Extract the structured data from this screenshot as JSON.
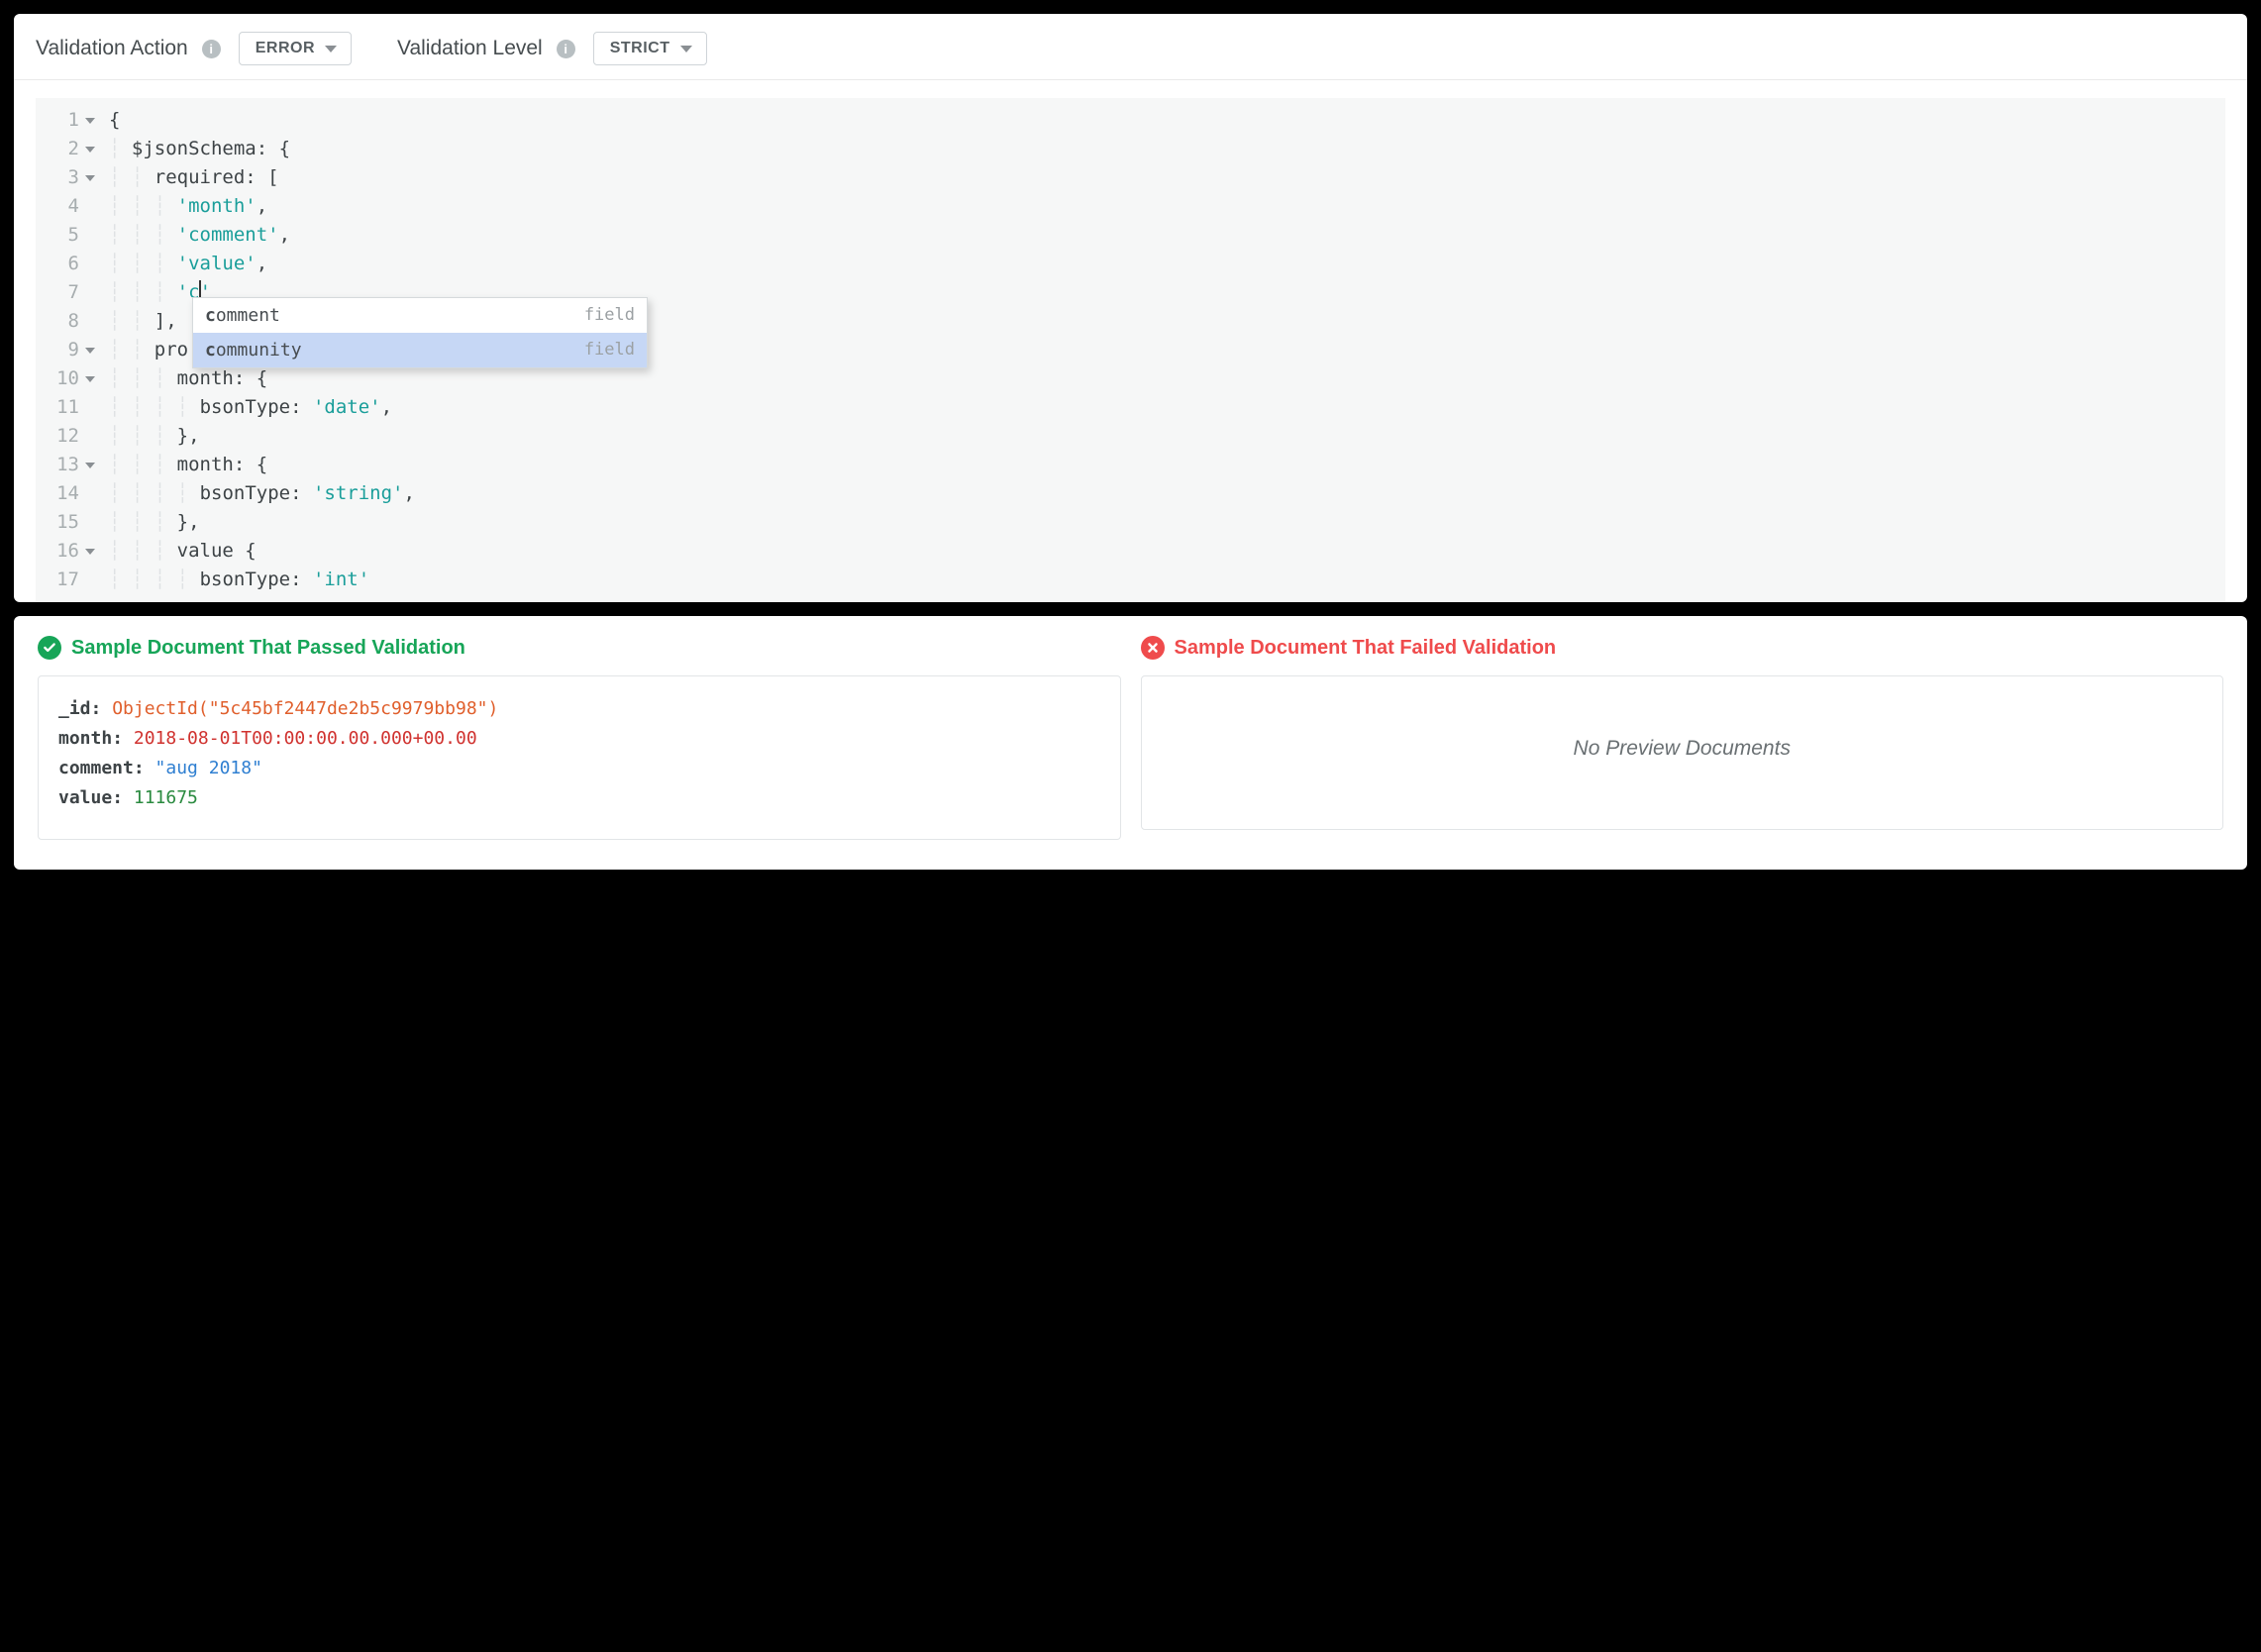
{
  "toolbar": {
    "action_label": "Validation Action",
    "action_value": "ERROR",
    "level_label": "Validation Level",
    "level_value": "STRICT"
  },
  "editor": {
    "lines": [
      {
        "n": 1,
        "fold": true,
        "indent": "",
        "text": "{"
      },
      {
        "n": 2,
        "fold": true,
        "indent": "  ",
        "text": "$jsonSchema: {"
      },
      {
        "n": 3,
        "fold": true,
        "indent": "    ",
        "text": "required: ["
      },
      {
        "n": 4,
        "fold": false,
        "indent": "      ",
        "str": "'month'",
        "suffix": ","
      },
      {
        "n": 5,
        "fold": false,
        "indent": "      ",
        "str": "'comment'",
        "suffix": ","
      },
      {
        "n": 6,
        "fold": false,
        "indent": "      ",
        "str": "'value'",
        "suffix": ","
      },
      {
        "n": 7,
        "fold": false,
        "indent": "      ",
        "typing_prefix": "'c",
        "typing_suffix": "'",
        "has_cursor": true
      },
      {
        "n": 8,
        "fold": false,
        "indent": "    ",
        "text": "],"
      },
      {
        "n": 9,
        "fold": true,
        "indent": "    ",
        "text": "pro"
      },
      {
        "n": 10,
        "fold": true,
        "indent": "      ",
        "text": "month: {"
      },
      {
        "n": 11,
        "fold": false,
        "indent": "        ",
        "key": "bsonType: ",
        "str": "'date'",
        "suffix": ","
      },
      {
        "n": 12,
        "fold": false,
        "indent": "      ",
        "text": "},"
      },
      {
        "n": 13,
        "fold": true,
        "indent": "      ",
        "text": "month: {"
      },
      {
        "n": 14,
        "fold": false,
        "indent": "        ",
        "key": "bsonType: ",
        "str": "'string'",
        "suffix": ","
      },
      {
        "n": 15,
        "fold": false,
        "indent": "      ",
        "text": "},"
      },
      {
        "n": 16,
        "fold": true,
        "indent": "      ",
        "text": "value {"
      },
      {
        "n": 17,
        "fold": false,
        "indent": "        ",
        "key": "bsonType: ",
        "str": "'int'"
      }
    ]
  },
  "autocomplete": {
    "items": [
      {
        "match": "c",
        "rest": "omment",
        "kind": "field",
        "selected": false
      },
      {
        "match": "c",
        "rest": "ommunity",
        "kind": "field",
        "selected": true
      }
    ]
  },
  "results": {
    "passed": {
      "header": "Sample Document That Passed Validation",
      "doc": {
        "_id_label": "_id",
        "_id_value": "ObjectId(\"5c45bf2447de2b5c9979bb98\")",
        "month_label": "month",
        "month_value": "2018-08-01T00:00:00.00.000+00.00",
        "comment_label": "comment",
        "comment_value": "\"aug 2018\"",
        "value_label": "value",
        "value_value": "111675"
      }
    },
    "failed": {
      "header": "Sample Document That Failed Validation",
      "empty_text": "No Preview Documents"
    }
  }
}
